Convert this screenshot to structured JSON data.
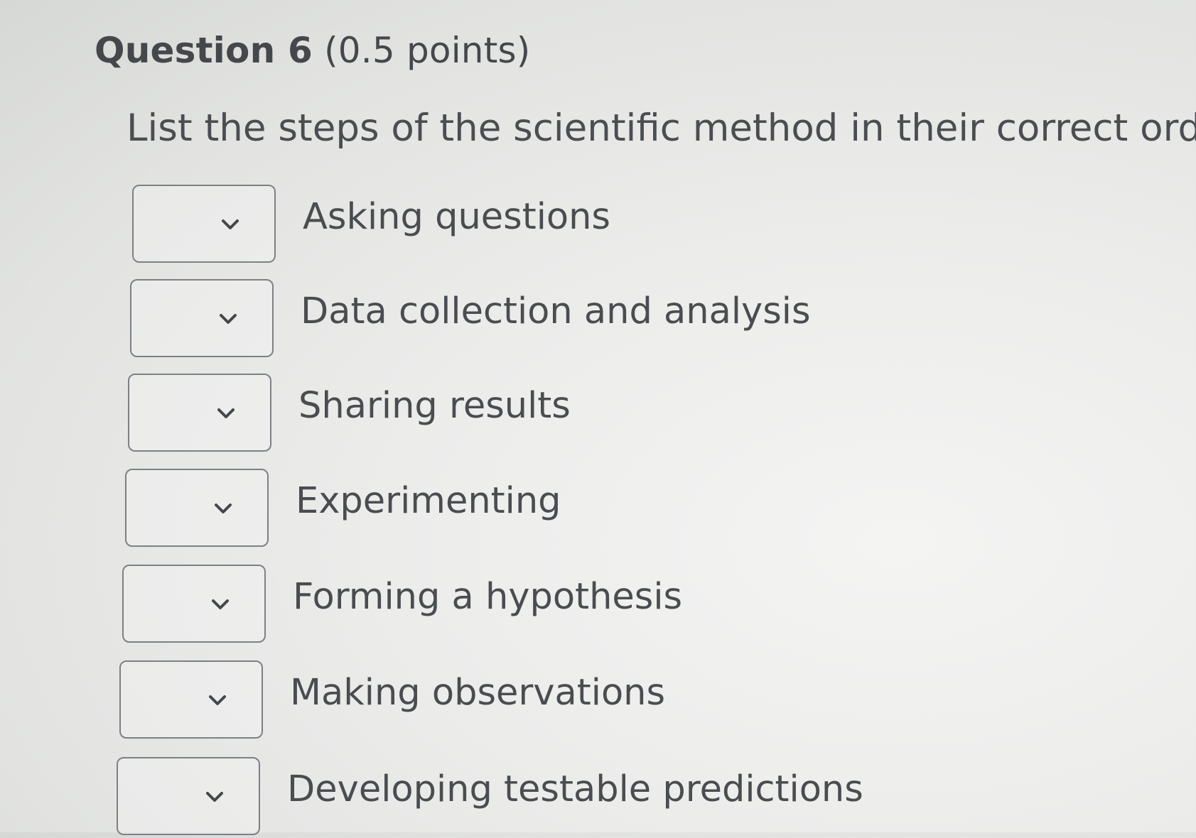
{
  "question": {
    "label": "Question 6",
    "points": "(0.5 points)",
    "prompt": "List the steps of the scientific method in their correct order."
  },
  "items": [
    {
      "selected": "",
      "label": "Asking questions"
    },
    {
      "selected": "",
      "label": "Data collection and analysis"
    },
    {
      "selected": "",
      "label": "Sharing results"
    },
    {
      "selected": "",
      "label": "Experimenting"
    },
    {
      "selected": "",
      "label": "Forming a hypothesis"
    },
    {
      "selected": "",
      "label": "Making observations"
    },
    {
      "selected": "",
      "label": "Developing testable predictions"
    }
  ],
  "icons": {
    "dropdown": "chevron-down-icon"
  },
  "colors": {
    "text": "#4a4d50",
    "border": "#7c8185",
    "background": "#ececeb"
  }
}
